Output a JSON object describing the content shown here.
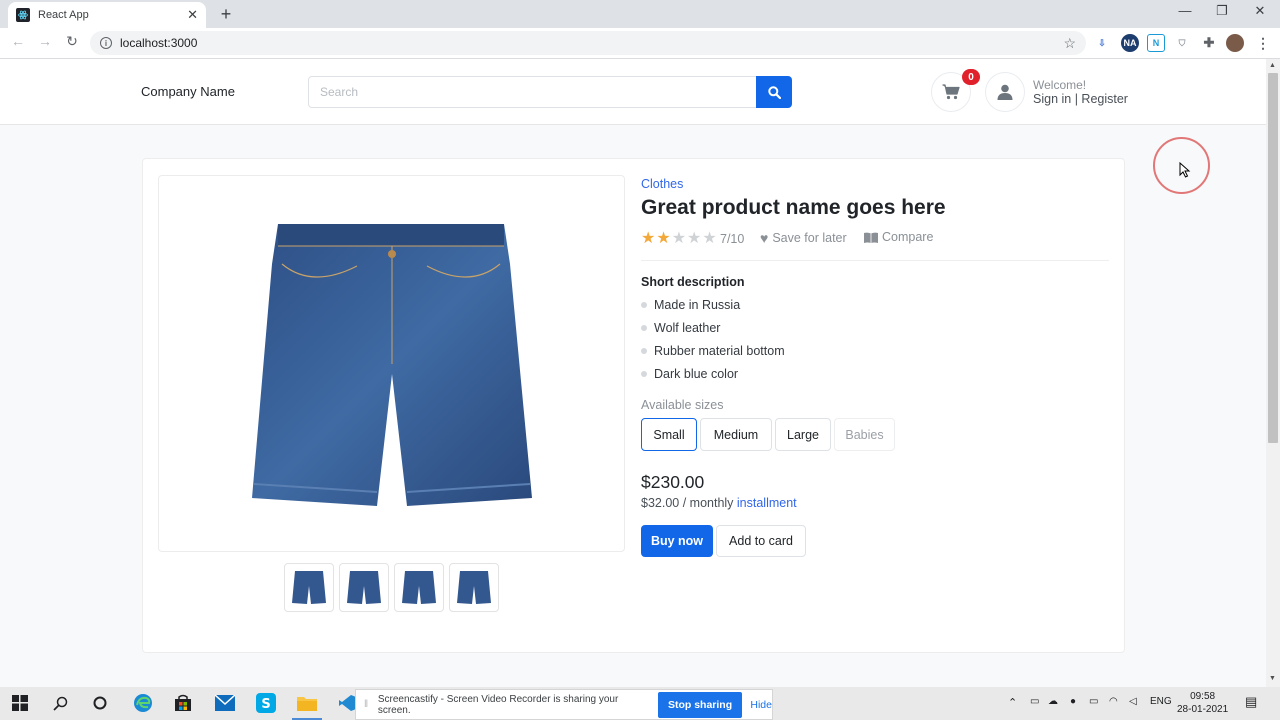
{
  "browser": {
    "tab_title": "React App",
    "url": "localhost:3000"
  },
  "header": {
    "company_name": "Company Name",
    "search_placeholder": "Search",
    "cart_count": "0",
    "welcome": "Welcome!",
    "signin": "Sign in | Register"
  },
  "product": {
    "category": "Clothes",
    "title": "Great product name goes here",
    "rating": {
      "stars_filled": 2,
      "stars_total": 5,
      "text": "7/10"
    },
    "save_label": "Save for later",
    "compare_label": "Compare",
    "short_desc_title": "Short description",
    "bullets": [
      "Made in Russia",
      "Wolf leather",
      "Rubber material bottom",
      "Dark blue color"
    ],
    "sizes_label": "Available sizes",
    "sizes": [
      "Small",
      "Medium",
      "Large",
      "Babies"
    ],
    "selected_size": "Small",
    "disabled_size": "Babies",
    "price": "$230.00",
    "installment_prefix": "$32.00 / monthly ",
    "installment_link": "installment",
    "buy_label": "Buy now",
    "add_label": "Add to card",
    "thumbnail_count": 4
  },
  "screencastify": {
    "message": "Screencastify - Screen Video Recorder is sharing your screen.",
    "stop": "Stop sharing",
    "hide": "Hide"
  },
  "taskbar": {
    "lang": "ENG",
    "time": "09:58",
    "date": "28-01-2021"
  },
  "colors": {
    "accent": "#1267e8",
    "link": "#3167eb",
    "star": "#f3a93a",
    "badge": "#e0212c"
  }
}
